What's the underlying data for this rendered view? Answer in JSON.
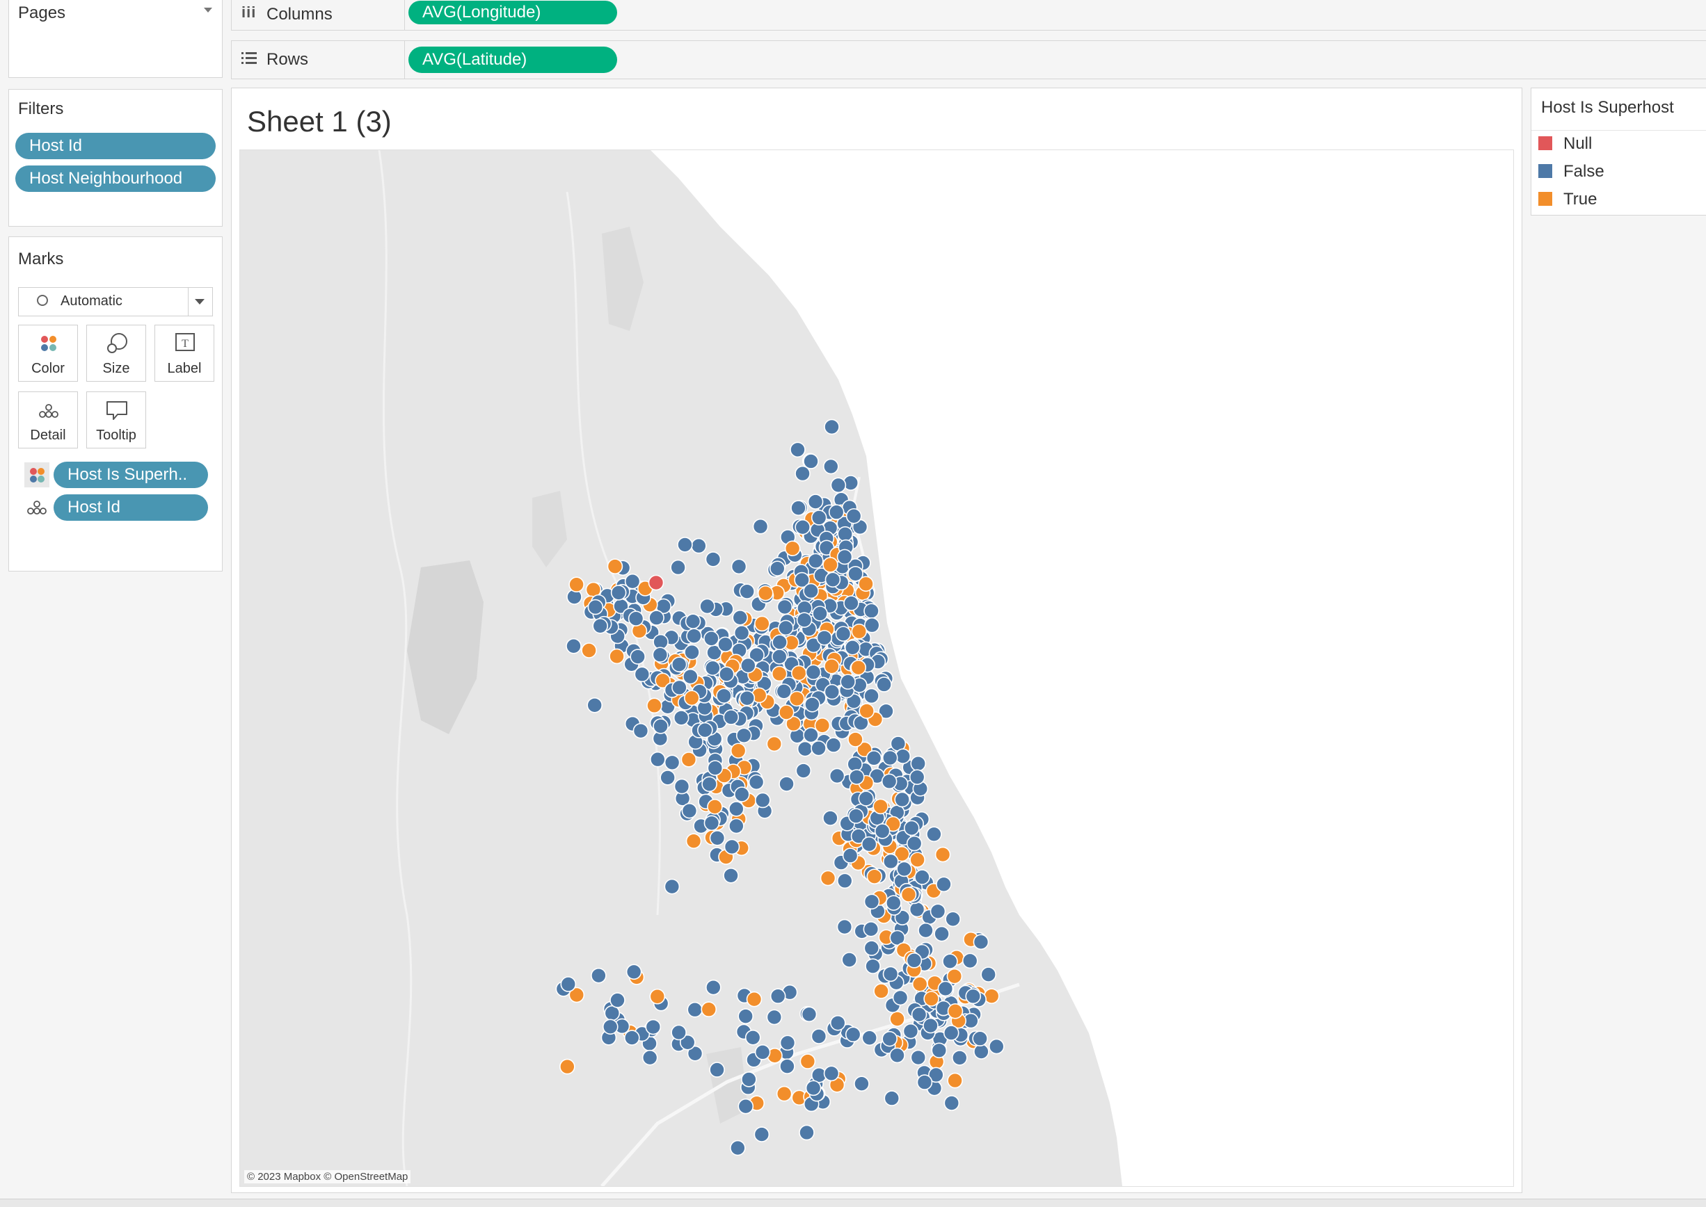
{
  "pages_shelf": {
    "title": "Pages"
  },
  "columns_shelf": {
    "label": "Columns",
    "pill": "AVG(Longitude)"
  },
  "rows_shelf": {
    "label": "Rows",
    "pill": "AVG(Latitude)"
  },
  "filters": {
    "title": "Filters",
    "items": [
      "Host Id",
      "Host Neighbourhood"
    ]
  },
  "marks": {
    "title": "Marks",
    "mark_type": "Automatic",
    "buttons": [
      "Color",
      "Size",
      "Label",
      "Detail",
      "Tooltip"
    ],
    "fields": [
      "Host Is Superh..",
      "Host Id"
    ]
  },
  "sheet": {
    "title": "Sheet 1 (3)",
    "attribution": "© 2023 Mapbox © OpenStreetMap"
  },
  "legend": {
    "title": "Host Is Superhost",
    "items": [
      {
        "label": "Null",
        "color": "#e15759"
      },
      {
        "label": "False",
        "color": "#4e79a7"
      },
      {
        "label": "True",
        "color": "#f28e2b"
      }
    ]
  },
  "colors": {
    "pill_blue": "#4996b2",
    "pill_green": "#00b180"
  }
}
